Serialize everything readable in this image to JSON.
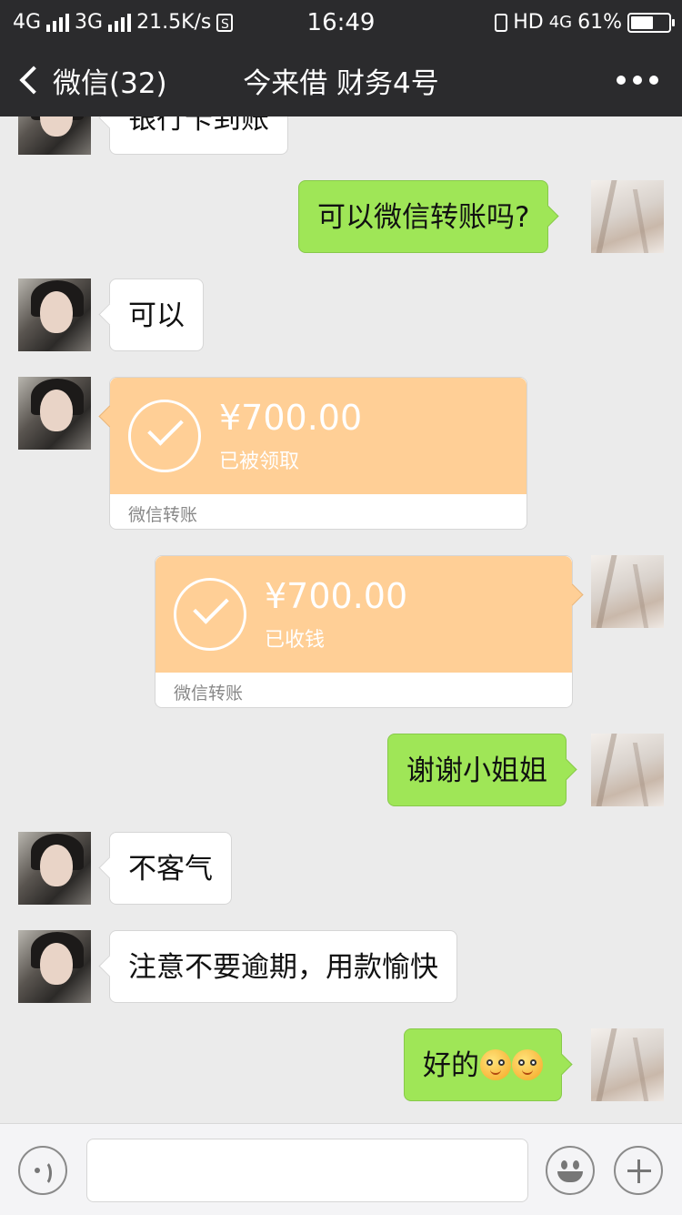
{
  "status_bar": {
    "network1": "4G",
    "network2": "3G",
    "speed": "21.5K/s",
    "sim_icon_text": "S",
    "time": "16:49",
    "hd": "HD",
    "network3": "4G",
    "battery_text": "61%",
    "battery_level": 0.61,
    "icons": [
      "signal-icon",
      "vibrate-icon",
      "battery-icon"
    ]
  },
  "nav": {
    "back_label": "微信(32)",
    "title": "今来借 财务4号",
    "more_icon": "more-dots-icon"
  },
  "messages": [
    {
      "side": "left",
      "text": "银行卡到账"
    },
    {
      "side": "right",
      "text": "可以微信转账吗?"
    },
    {
      "side": "left",
      "text": "可以"
    },
    {
      "side": "left",
      "type": "transfer",
      "amount": "¥700.00",
      "status": "已被领取",
      "footer": "微信转账"
    },
    {
      "side": "right",
      "type": "transfer",
      "amount": "¥700.00",
      "status": "已收钱",
      "footer": "微信转账"
    },
    {
      "side": "right",
      "text": "谢谢小姐姐"
    },
    {
      "side": "left",
      "text": "不客气"
    },
    {
      "side": "left",
      "text": "注意不要逾期，用款愉快"
    },
    {
      "side": "right",
      "text": "好的",
      "emojis": [
        "grin-emoji",
        "grin-emoji"
      ]
    }
  ],
  "input_bar": {
    "icons": [
      "voice-icon",
      "emoji-icon",
      "plus-icon"
    ]
  },
  "colors": {
    "bar_bg": "#2b2b2d",
    "chat_bg": "#ebebeb",
    "self_bubble": "#9fe657",
    "transfer_card": "#ffcf96"
  }
}
